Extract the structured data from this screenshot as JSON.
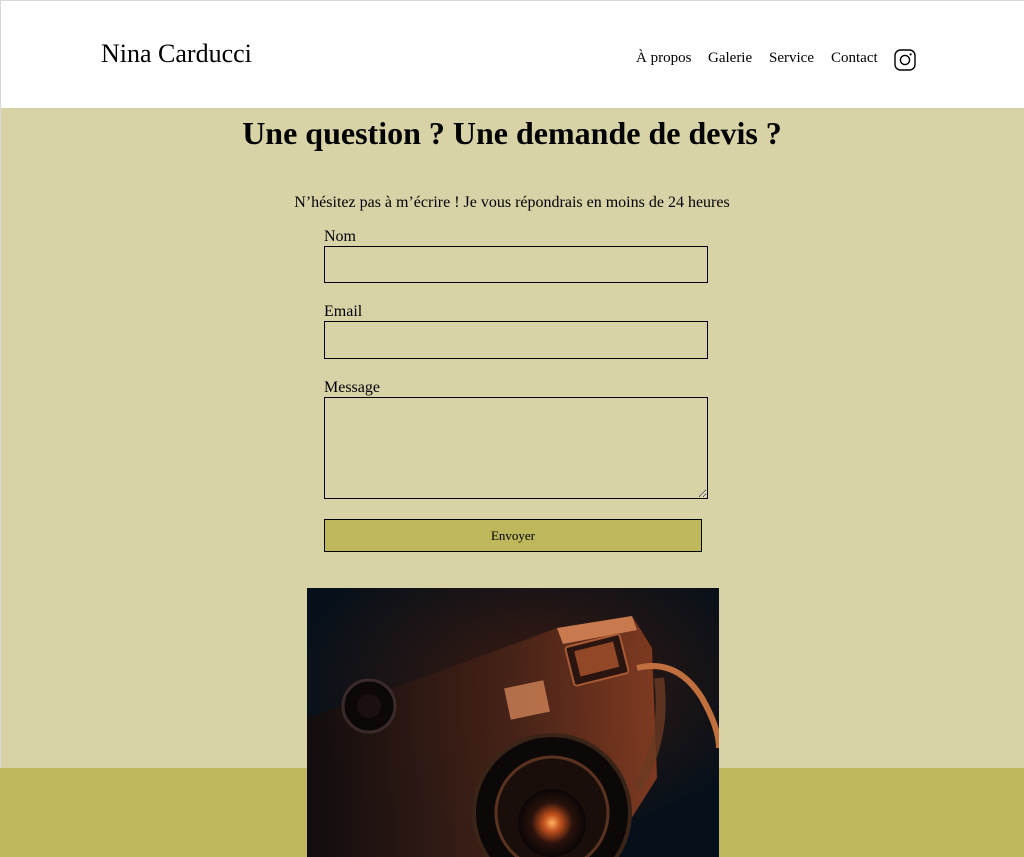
{
  "header": {
    "brand": "Nina Carducci",
    "nav": [
      "À propos",
      "Galerie",
      "Service",
      "Contact"
    ],
    "social_icon": "instagram-icon"
  },
  "contact": {
    "title": "Une question ? Une demande de devis ?",
    "intro": "N’hésitez pas à m’écrire ! Je vous répondrais en moins de 24 heures",
    "name_label": "Nom",
    "name_value": "",
    "email_label": "Email",
    "email_value": "",
    "message_label": "Message",
    "message_value": "",
    "submit_label": "Envoyer"
  },
  "colors": {
    "section_bg": "#d7d3a7",
    "accent": "#bfb75b",
    "header_bg": "#ffffff"
  }
}
